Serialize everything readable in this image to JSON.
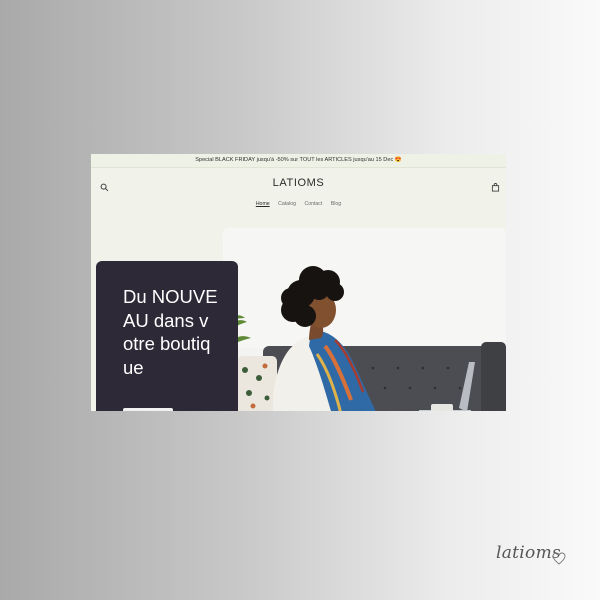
{
  "announcement": {
    "text": "Special BLACK FRIDAY jusqu'à -50% sur TOUT les ARTICLES jusqu'au 15 Dec 😍"
  },
  "store": {
    "logo": "LATIOMS"
  },
  "nav": {
    "items": [
      "Home",
      "Catalog",
      "Contact",
      "Blog"
    ],
    "active": "Home"
  },
  "hero": {
    "title": "Du NOUVEAU dans votre boutique"
  },
  "watermark": {
    "text": "latioms"
  },
  "icons": {
    "search": "search-icon",
    "cart": "shopping-bag-icon",
    "watermark": "heart-icon"
  },
  "colors": {
    "promo_bg": "#2e2937",
    "page_bg": "#f1f3ea",
    "announcement_bg": "#eef1e6"
  }
}
